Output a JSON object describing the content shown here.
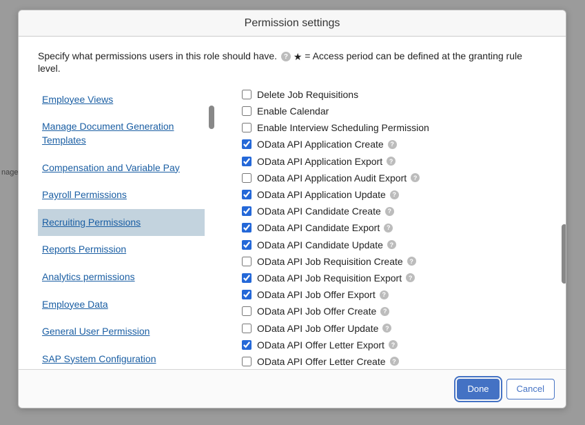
{
  "modal": {
    "title": "Permission settings",
    "intro_prefix": "Specify what permissions users in this role should have.",
    "intro_star": "★",
    "intro_suffix": "= Access period can be defined at the granting rule level."
  },
  "categories": [
    {
      "label": "Employee Views",
      "selected": false
    },
    {
      "label": "Manage Document Generation Templates",
      "selected": false
    },
    {
      "label": "Compensation and Variable Pay",
      "selected": false
    },
    {
      "label": "Payroll Permissions",
      "selected": false
    },
    {
      "label": "Recruiting Permissions",
      "selected": true
    },
    {
      "label": "Reports Permission",
      "selected": false
    },
    {
      "label": "Analytics permissions",
      "selected": false
    },
    {
      "label": "Employee Data",
      "selected": false
    },
    {
      "label": "General User Permission",
      "selected": false
    },
    {
      "label": "SAP System Configuration",
      "selected": false
    }
  ],
  "permissions": [
    {
      "label": "Delete Job Requisitions",
      "checked": false,
      "help": false
    },
    {
      "label": "Enable Calendar",
      "checked": false,
      "help": false
    },
    {
      "label": "Enable Interview Scheduling Permission",
      "checked": false,
      "help": false
    },
    {
      "label": "OData API Application Create",
      "checked": true,
      "help": true
    },
    {
      "label": "OData API Application Export",
      "checked": true,
      "help": true
    },
    {
      "label": "OData API Application Audit Export",
      "checked": false,
      "help": true
    },
    {
      "label": "OData API Application Update",
      "checked": true,
      "help": true
    },
    {
      "label": "OData API Candidate Create",
      "checked": true,
      "help": true
    },
    {
      "label": "OData API Candidate Export",
      "checked": true,
      "help": true
    },
    {
      "label": "OData API Candidate Update",
      "checked": true,
      "help": true
    },
    {
      "label": "OData API Job Requisition Create",
      "checked": false,
      "help": true
    },
    {
      "label": "OData API Job Requisition Export",
      "checked": true,
      "help": true
    },
    {
      "label": "OData API Job Offer Export",
      "checked": true,
      "help": true
    },
    {
      "label": "OData API Job Offer Create",
      "checked": false,
      "help": true
    },
    {
      "label": "OData API Job Offer Update",
      "checked": false,
      "help": true
    },
    {
      "label": "OData API Offer Letter Export",
      "checked": true,
      "help": true
    },
    {
      "label": "OData API Offer Letter Create",
      "checked": false,
      "help": true
    }
  ],
  "buttons": {
    "done": "Done",
    "cancel": "Cancel"
  },
  "bg": {
    "crumb": "nage"
  }
}
